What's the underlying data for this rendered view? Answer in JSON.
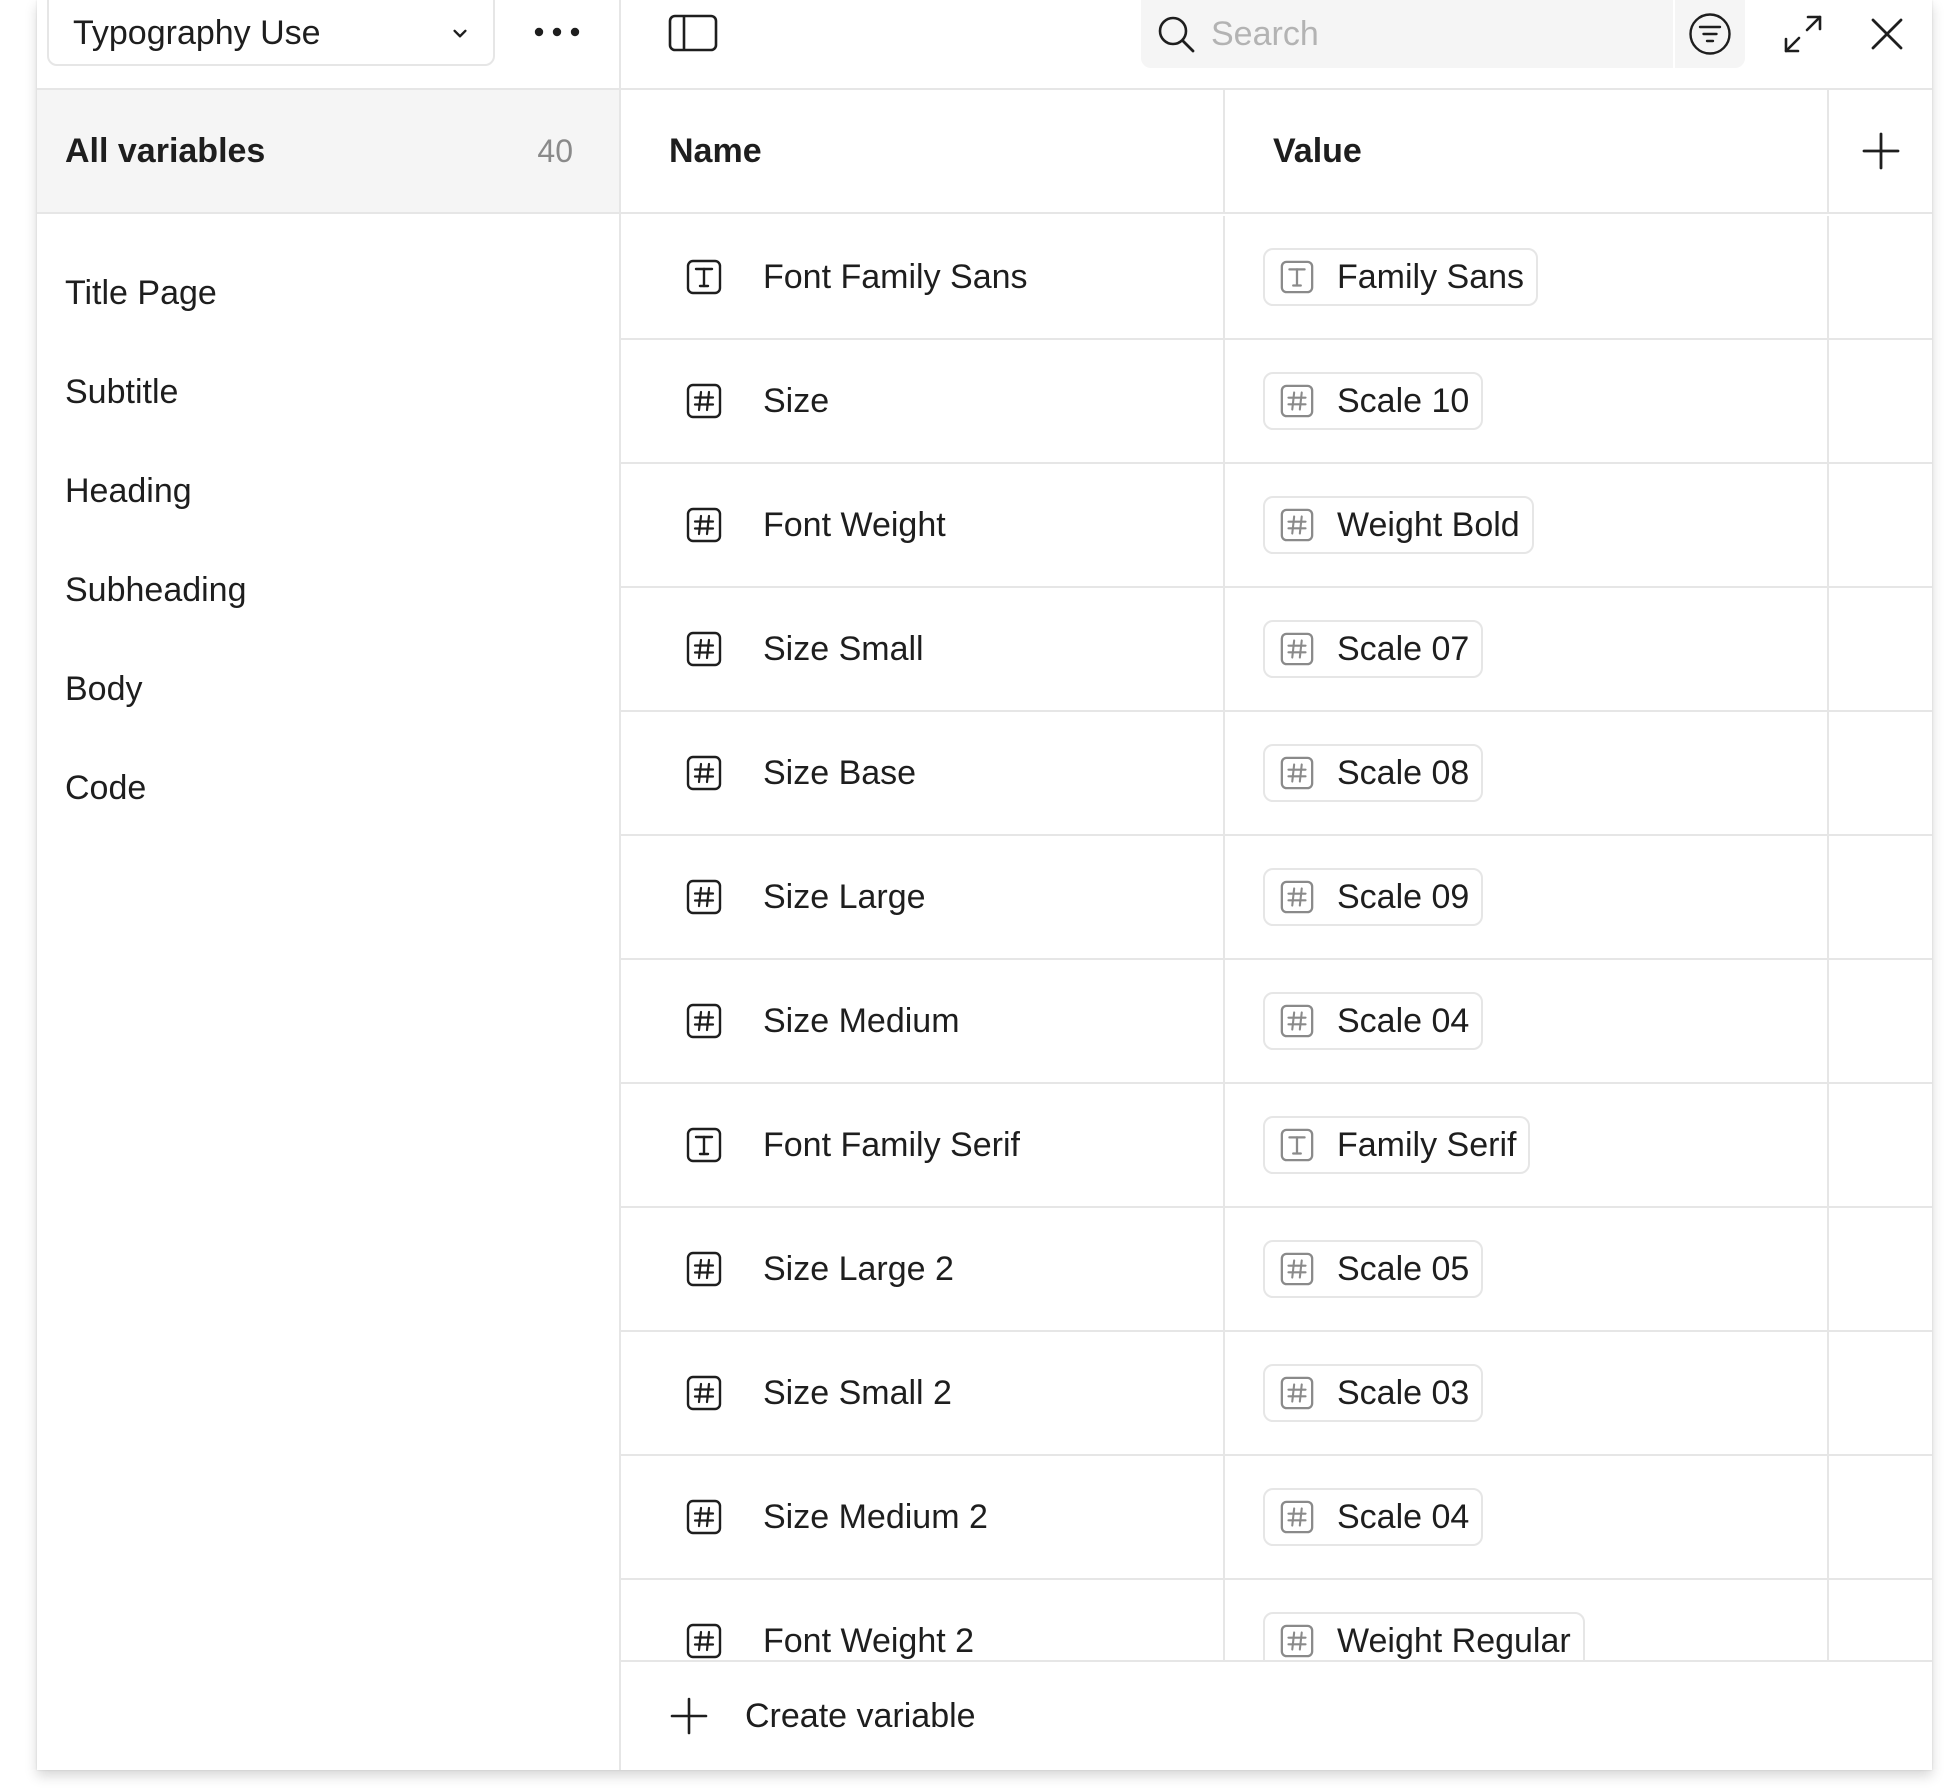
{
  "collection": {
    "name": "Typography Use"
  },
  "search": {
    "placeholder": "Search"
  },
  "sidebar": {
    "all_label": "All variables",
    "all_count": "40",
    "groups": [
      {
        "label": "Title Page"
      },
      {
        "label": "Subtitle"
      },
      {
        "label": "Heading"
      },
      {
        "label": "Subheading"
      },
      {
        "label": "Body"
      },
      {
        "label": "Code"
      }
    ]
  },
  "table": {
    "name_header": "Name",
    "value_header": "Value",
    "rows": [
      {
        "type": "text-type-icon",
        "name": "Font Family Sans",
        "value": "Family Sans"
      },
      {
        "type": "number-type-icon",
        "name": "Size",
        "value": "Scale 10"
      },
      {
        "type": "number-type-icon",
        "name": "Font Weight",
        "value": "Weight Bold"
      },
      {
        "type": "number-type-icon",
        "name": "Size Small",
        "value": "Scale 07"
      },
      {
        "type": "number-type-icon",
        "name": "Size Base",
        "value": "Scale 08"
      },
      {
        "type": "number-type-icon",
        "name": "Size Large",
        "value": "Scale 09"
      },
      {
        "type": "number-type-icon",
        "name": "Size Medium",
        "value": "Scale 04"
      },
      {
        "type": "text-type-icon",
        "name": "Font Family Serif",
        "value": "Family Serif"
      },
      {
        "type": "number-type-icon",
        "name": "Size Large 2",
        "value": "Scale 05"
      },
      {
        "type": "number-type-icon",
        "name": "Size Small 2",
        "value": "Scale 03"
      },
      {
        "type": "number-type-icon",
        "name": "Size Medium 2",
        "value": "Scale 04"
      },
      {
        "type": "number-type-icon",
        "name": "Font Weight 2",
        "value": "Weight Regular"
      }
    ]
  },
  "footer": {
    "create_label": "Create variable"
  },
  "icons": {
    "collection_chevron": "chevron-down-icon",
    "more": "more-horizontal-icon",
    "sidebar_toggle": "sidebar-toggle-icon",
    "search": "search-icon",
    "filter": "filter-icon",
    "expand": "expand-icon",
    "close": "close-icon",
    "add_column": "plus-icon",
    "create": "plus-icon"
  },
  "colors": {
    "text": "#1e1e1e",
    "muted": "#8a8a8a",
    "border": "#e6e6e6",
    "selected_bg": "#f5f5f5",
    "placeholder": "#b3b3b3"
  }
}
